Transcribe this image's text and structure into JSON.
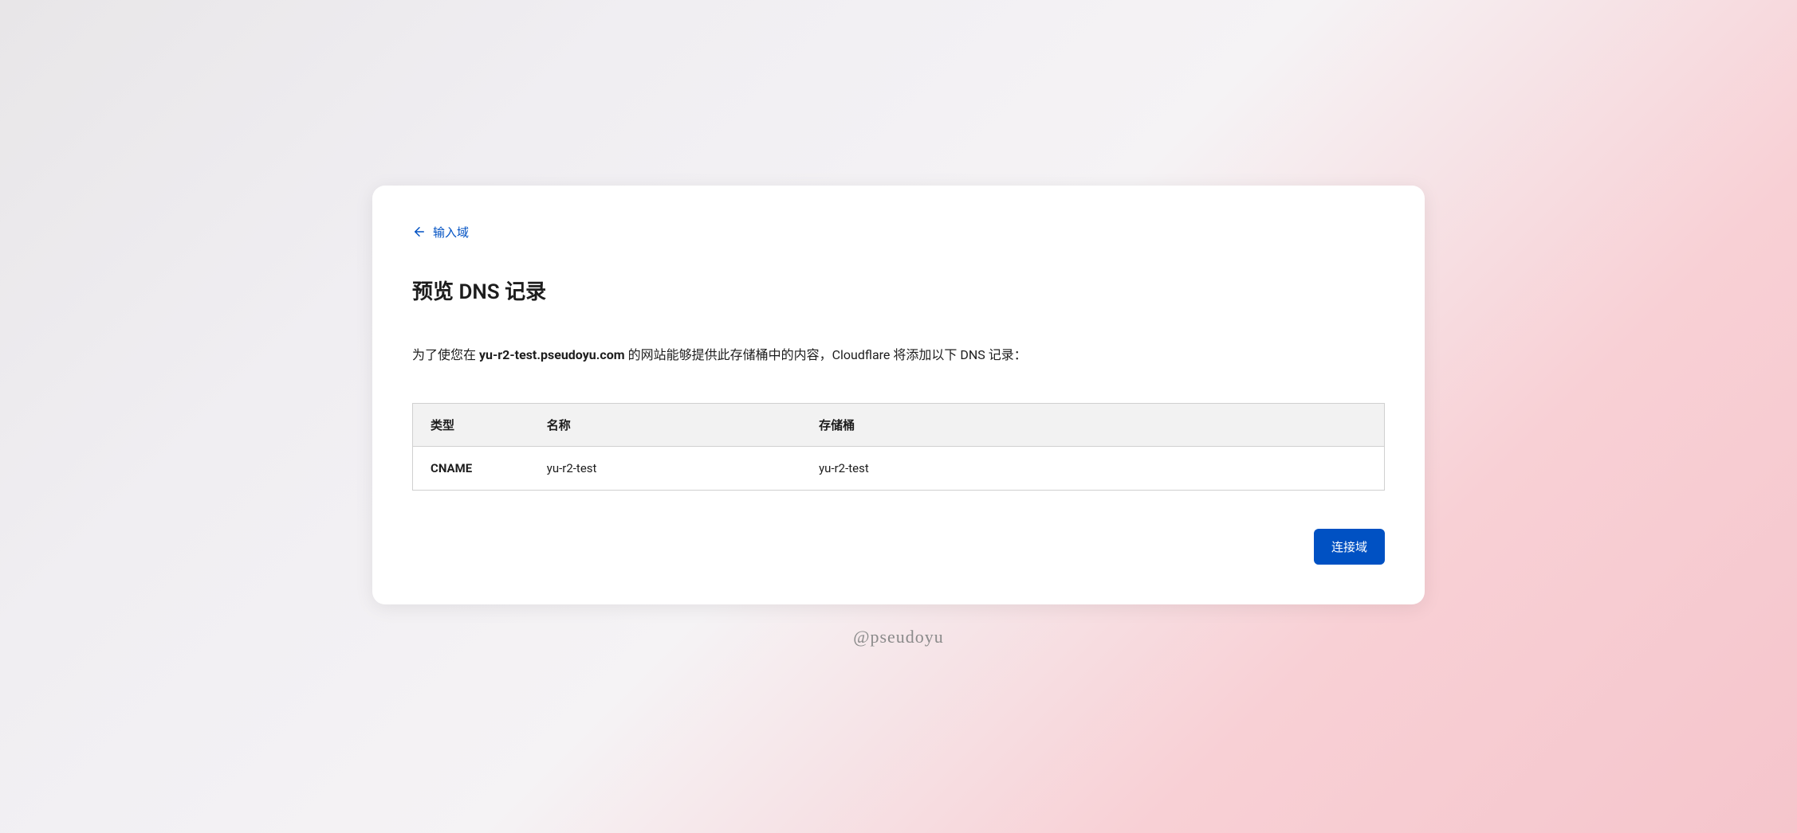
{
  "back_link": {
    "label": "输入域"
  },
  "title": "预览 DNS 记录",
  "description": {
    "prefix": "为了使您在 ",
    "domain": "yu-r2-test.pseudoyu.com",
    "suffix": " 的网站能够提供此存储桶中的内容，Cloudflare 将添加以下 DNS 记录："
  },
  "table": {
    "headers": {
      "type": "类型",
      "name": "名称",
      "bucket": "存储桶"
    },
    "row": {
      "type": "CNAME",
      "name": "yu-r2-test",
      "bucket": "yu-r2-test"
    }
  },
  "actions": {
    "connect": "连接域"
  },
  "watermark": "@pseudoyu"
}
